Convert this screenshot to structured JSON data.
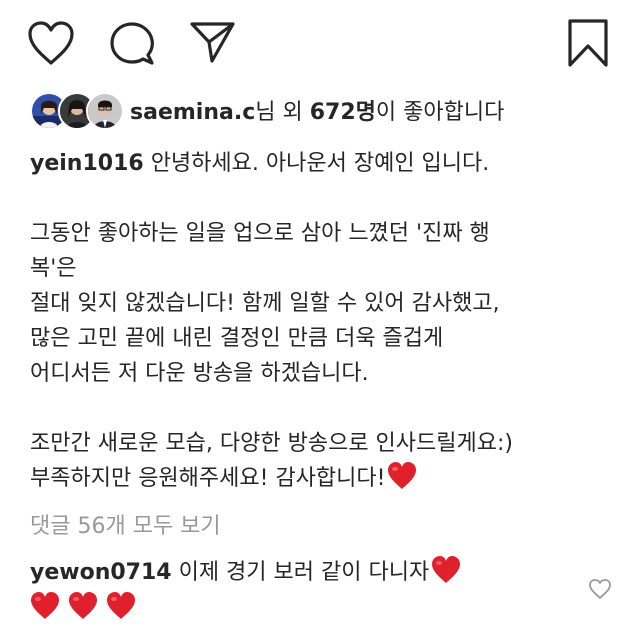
{
  "post": {
    "liked_by": {
      "username": "saemina.c",
      "middle": "님 외 ",
      "count": "672명",
      "suffix": "이 좋아합니다"
    },
    "caption": {
      "username": "yein1016",
      "line1": " 안녕하세요. 아나운서 장예인 입니다.",
      "para2_1": "그동안 좋아하는 일을 업으로 삼아 느꼈던 '진짜 행",
      "para2_2": "복'은",
      "para2_3": "절대 잊지 않겠습니다! 함께 일할 수 있어 감사했고,",
      "para2_4": "많은 고민 끝에 내린 결정인 만큼 더욱 즐겁게",
      "para2_5": "어디서든 저 다운 방송을 하겠습니다.",
      "para3_1": "조만간 새로운 모습, 다양한 방송으로 인사드릴게요:)",
      "para3_2": "부족하지만 응원해주세요! 감사합니다!"
    },
    "view_comments": "댓글 56개 모두 보기",
    "comment": {
      "username": "yewon0714",
      "text": " 이제 경기 보러 같이 다니자"
    }
  },
  "icons": [
    "heart-icon",
    "comment-icon",
    "share-icon",
    "bookmark-icon",
    "heart-emoji",
    "small-heart-icon"
  ],
  "colors": {
    "text": "#262626",
    "muted": "#999999",
    "heart_emoji": "#e0202c"
  }
}
